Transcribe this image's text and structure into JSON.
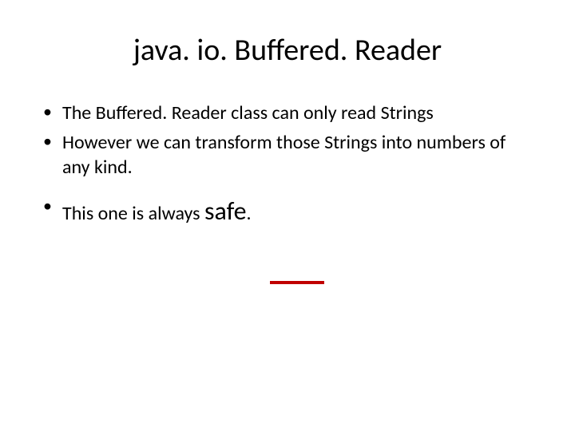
{
  "title": "java. io. Buffered. Reader",
  "bullets": {
    "item1": "The Buffered. Reader class can only read Strings",
    "item2": "However we can transform those Strings into numbers of any kind.",
    "item3_prefix": "This one is always ",
    "item3_emph": "safe",
    "item3_suffix": "."
  },
  "colors": {
    "underline": "#c00000"
  }
}
